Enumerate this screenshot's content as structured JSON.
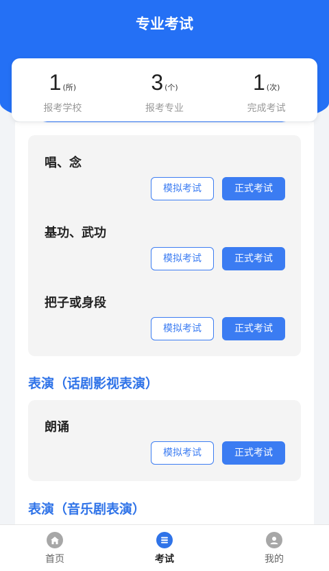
{
  "header": {
    "title": "专业考试"
  },
  "stats": [
    {
      "value": "1",
      "unit": "(所)",
      "label": "报考学校"
    },
    {
      "value": "3",
      "unit": "(个)",
      "label": "报考专业"
    },
    {
      "value": "1",
      "unit": "(次)",
      "label": "完成考试"
    }
  ],
  "buttons": {
    "mock": "模拟考试",
    "formal": "正式考试"
  },
  "card1": {
    "items": [
      {
        "name": "唱、念"
      },
      {
        "name": "基功、武功"
      },
      {
        "name": "把子或身段"
      }
    ]
  },
  "section2": {
    "title": "表演（话剧影视表演）"
  },
  "card2": {
    "items": [
      {
        "name": "朗诵"
      }
    ]
  },
  "section3": {
    "title": "表演（音乐剧表演）"
  },
  "tabbar": {
    "tabs": [
      {
        "label": "首页",
        "icon": "home-icon"
      },
      {
        "label": "考试",
        "icon": "exam-icon"
      },
      {
        "label": "我的",
        "icon": "profile-icon"
      }
    ]
  },
  "colors": {
    "primary": "#2470f5",
    "button": "#3b7cf2",
    "section": "#2f73e8"
  }
}
